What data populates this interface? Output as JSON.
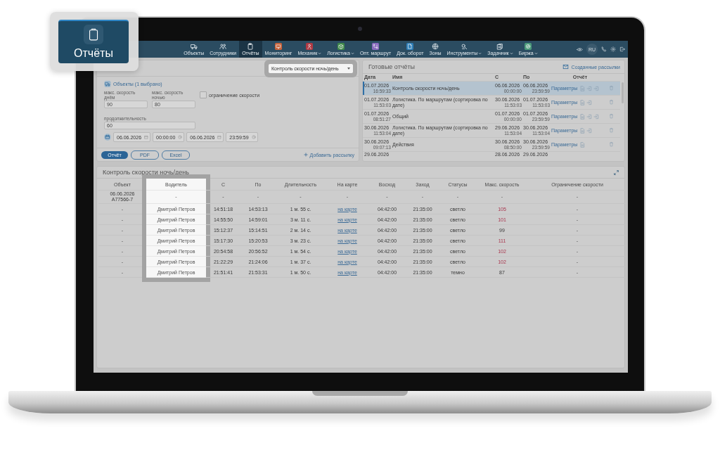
{
  "callout": {
    "label": "Отчёты"
  },
  "nav": {
    "items": [
      {
        "label": "Объекты",
        "selected": false,
        "dropdown": false
      },
      {
        "label": "Сотрудники",
        "selected": false,
        "dropdown": false
      },
      {
        "label": "Отчёты",
        "selected": true,
        "dropdown": false
      },
      {
        "label": "Мониторинг",
        "selected": false,
        "dropdown": false,
        "color": "#c8643c"
      },
      {
        "label": "Механик",
        "selected": false,
        "dropdown": true,
        "color": "#b03a44"
      },
      {
        "label": "Логистика",
        "selected": false,
        "dropdown": true,
        "color": "#3f8a4a"
      },
      {
        "label": "Опт. маршрут",
        "selected": false,
        "dropdown": false,
        "color": "#8a6cc0"
      },
      {
        "label": "Док. оборот",
        "selected": false,
        "dropdown": false,
        "color": "#2f7fb8"
      },
      {
        "label": "Зоны",
        "selected": false,
        "dropdown": false
      },
      {
        "label": "Инструменты",
        "selected": false,
        "dropdown": true
      },
      {
        "label": "Задачник",
        "selected": false,
        "dropdown": true
      },
      {
        "label": "Биржа",
        "selected": false,
        "dropdown": true,
        "color": "#4a9a7a"
      }
    ],
    "language": "RU"
  },
  "report_selector": {
    "value": "Контроль скорости ночь/день",
    "highlighted": true
  },
  "params": {
    "objects_link": "Объекты (1 выбрано)",
    "fields": [
      {
        "label": "макс. скорость днём",
        "value": "90"
      },
      {
        "label": "макс. скорость ночью",
        "value": "80"
      },
      {
        "label": "продолжительность",
        "value": "60"
      }
    ],
    "speed_limit": {
      "label": "ограничение скорости",
      "checked": false
    },
    "period": {
      "date_from": "06.06.2026",
      "time_from": "00:00:00",
      "date_to": "06.06.2026",
      "time_to": "23:59:59"
    },
    "buttons": [
      {
        "label": "Отчёт",
        "kind": "primary"
      },
      {
        "label": "PDF",
        "kind": "outline"
      },
      {
        "label": "Excel",
        "kind": "outline"
      }
    ],
    "add_mailing": "Добавить рассылку"
  },
  "ready_reports": {
    "title": "Готовые отчёты",
    "mailings_link": "Созданные рассылки",
    "columns": [
      "Дата",
      "Имя",
      "С",
      "По",
      "Отчёт"
    ],
    "rows": [
      {
        "date": "01.07.2026",
        "time": "16:59:33",
        "name": "Контроль скорости ночь/день",
        "from_date": "06.06.2026",
        "from_time": "00:00:00",
        "to_date": "06.06.2026",
        "to_time": "23:59:59",
        "params_link": "Параметры",
        "files": [
          {
            "kind": "document"
          },
          {
            "kind": "export"
          },
          {
            "kind": "export"
          }
        ],
        "selected": true
      },
      {
        "date": "01.07.2026",
        "time": "11:53:03",
        "name": "Логистика. По маршрутам (сортировка по дате)",
        "from_date": "30.06.2026",
        "from_time": "11:53:03",
        "to_date": "01.07.2026",
        "to_time": "11:53:03",
        "params_link": "Параметры",
        "files": [
          {
            "kind": "document"
          },
          {
            "kind": "export"
          }
        ],
        "selected": false
      },
      {
        "date": "01.07.2026",
        "time": "08:51:27",
        "name": "Общий",
        "from_date": "01.07.2026",
        "from_time": "00:00:00",
        "to_date": "01.07.2026",
        "to_time": "23:59:59",
        "params_link": "Параметры",
        "files": [
          {
            "kind": "document"
          },
          {
            "kind": "export"
          },
          {
            "kind": "export"
          }
        ],
        "selected": false
      },
      {
        "date": "30.06.2026",
        "time": "11:53:04",
        "name": "Логистика. По маршрутам (сортировка по дате)",
        "from_date": "29.06.2026",
        "from_time": "11:53:04",
        "to_date": "30.06.2026",
        "to_time": "11:53:04",
        "params_link": "Параметры",
        "files": [
          {
            "kind": "document"
          },
          {
            "kind": "export"
          }
        ],
        "selected": false
      },
      {
        "date": "30.06.2026",
        "time": "09:07:13",
        "name": "Действия",
        "from_date": "30.06.2026",
        "from_time": "08:50:00",
        "to_date": "30.06.2026",
        "to_time": "23:59:59",
        "params_link": "Параметры",
        "files": [
          {
            "kind": "document"
          }
        ],
        "selected": false
      },
      {
        "date": "29.06.2026",
        "from_date": "28.06.2026",
        "to_date": "29.06.2026",
        "selected": false
      }
    ]
  },
  "result": {
    "title": "Контроль скорости ночь/день",
    "columns": [
      {
        "label": "Объект",
        "highlighted": false
      },
      {
        "label": "Водитель",
        "highlighted": true
      },
      {
        "label": "С",
        "highlighted": false
      },
      {
        "label": "По",
        "highlighted": false
      },
      {
        "label": "Длительность",
        "highlighted": false
      },
      {
        "label": "На карте",
        "highlighted": false
      },
      {
        "label": "Восход",
        "highlighted": false
      },
      {
        "label": "Заход",
        "highlighted": false
      },
      {
        "label": "Статусы",
        "highlighted": false
      },
      {
        "label": "Макс. скорость",
        "highlighted": false
      },
      {
        "label": "Ограничение скорости",
        "highlighted": false
      }
    ],
    "group": {
      "date": "06.06.2026",
      "object": "А77566-7",
      "cells": [
        "-",
        "-",
        "-",
        "-",
        "-",
        "-",
        "-",
        "-",
        "-",
        "-"
      ]
    },
    "rows": [
      {
        "object": "-",
        "driver": "Дмитрий Петров",
        "from": "14:51:18",
        "to": "14:53:13",
        "duration": "1 м. 55 с.",
        "map_link": "на карте",
        "sunrise": "04:42:00",
        "sunset": "21:35:00",
        "status": "светло",
        "max_speed": "105",
        "exceeded": true,
        "limit": "-"
      },
      {
        "object": "-",
        "driver": "Дмитрий Петров",
        "from": "14:55:50",
        "to": "14:59:01",
        "duration": "3 м. 11 с.",
        "map_link": "на карте",
        "sunrise": "04:42:00",
        "sunset": "21:35:00",
        "status": "светло",
        "max_speed": "101",
        "exceeded": true,
        "limit": "-"
      },
      {
        "object": "-",
        "driver": "Дмитрий Петров",
        "from": "15:12:37",
        "to": "15:14:51",
        "duration": "2 м. 14 с.",
        "map_link": "на карте",
        "sunrise": "04:42:00",
        "sunset": "21:35:00",
        "status": "светло",
        "max_speed": "99",
        "exceeded": false,
        "limit": "-"
      },
      {
        "object": "-",
        "driver": "Дмитрий Петров",
        "from": "15:17:30",
        "to": "15:20:53",
        "duration": "3 м. 23 с.",
        "map_link": "на карте",
        "sunrise": "04:42:00",
        "sunset": "21:35:00",
        "status": "светло",
        "max_speed": "111",
        "exceeded": true,
        "limit": "-"
      },
      {
        "object": "-",
        "driver": "Дмитрий Петров",
        "from": "20:54:58",
        "to": "20:56:52",
        "duration": "1 м. 54 с.",
        "map_link": "на карте",
        "sunrise": "04:42:00",
        "sunset": "21:35:00",
        "status": "светло",
        "max_speed": "102",
        "exceeded": true,
        "limit": "-"
      },
      {
        "object": "-",
        "driver": "Дмитрий Петров",
        "from": "21:22:29",
        "to": "21:24:06",
        "duration": "1 м. 37 с.",
        "map_link": "на карте",
        "sunrise": "04:42:00",
        "sunset": "21:35:00",
        "status": "светло",
        "max_speed": "102",
        "exceeded": true,
        "limit": "-"
      },
      {
        "object": "-",
        "driver": "Дмитрий Петров",
        "from": "21:51:41",
        "to": "21:53:31",
        "duration": "1 м. 50 с.",
        "map_link": "на карте",
        "sunrise": "04:42:00",
        "sunset": "21:35:00",
        "status": "темно",
        "max_speed": "87",
        "exceeded": false,
        "limit": "-"
      }
    ]
  }
}
